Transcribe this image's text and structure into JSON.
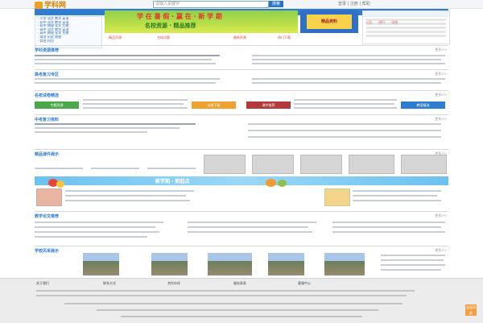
{
  "header": {
    "logo": "学科网",
    "search_placeholder": "请输入关键字",
    "search_button": "搜索",
    "toplinks": "登录 | 注册 | 帮助"
  },
  "nav": {
    "items": [
      "首页",
      "小学",
      "初中",
      "高中",
      "试卷",
      "课件",
      "教案",
      "学案",
      "素材",
      "视频",
      "论文",
      "专题"
    ]
  },
  "left_menu": [
    "· 小学 语文 数学 英语",
    "· 初中 语文 数学 英语",
    "· 初中 物理 化学 生物",
    "· 高中 语文 数学 英语",
    "· 高中 物理 化学 生物",
    "· 政治 历史 地理",
    "· 其他 科目"
  ],
  "banner": {
    "line1": "学 在 暑 假 · 赢 在 · 新 学 期",
    "line2": "名校资源 · 精品推荐"
  },
  "ad_right": {
    "text": "精品资料"
  },
  "rightbox": {
    "tabs": [
      "公告",
      "排行",
      "动态"
    ]
  },
  "sublinks": [
    "精品资源",
    "名校试题",
    "最新资源",
    "热门下载"
  ],
  "sections": [
    {
      "title": "学科资源推荐",
      "more": "更多>>"
    },
    {
      "title": "高考复习专区",
      "more": "更多>>"
    },
    {
      "title": "名校试卷精选",
      "more": "更多>>"
    },
    {
      "title": "中考复习资料",
      "more": "更多>>"
    },
    {
      "title": "精品课件展示",
      "more": "更多>>"
    },
    {
      "title": "教学素材专区",
      "more": "更多>>"
    },
    {
      "title": "教学论文推荐",
      "more": "更多>>"
    },
    {
      "title": "学校风采展示",
      "more": "更多>>"
    }
  ],
  "colorboxes": [
    {
      "label": "专题资源",
      "color": "#4aa84a"
    },
    {
      "label": "试卷下载",
      "color": "#f0a030"
    },
    {
      "label": "课件推荐",
      "color": "#b23a3a"
    },
    {
      "label": "教案精选",
      "color": "#2e7dd1"
    }
  ],
  "blue_band": {
    "text": "新学期 · 新起点"
  },
  "footer": {
    "cols": [
      "关于我们",
      "联系方式",
      "合作伙伴",
      "服务条款",
      "客服中心"
    ],
    "float_btn": "返回顶部"
  }
}
